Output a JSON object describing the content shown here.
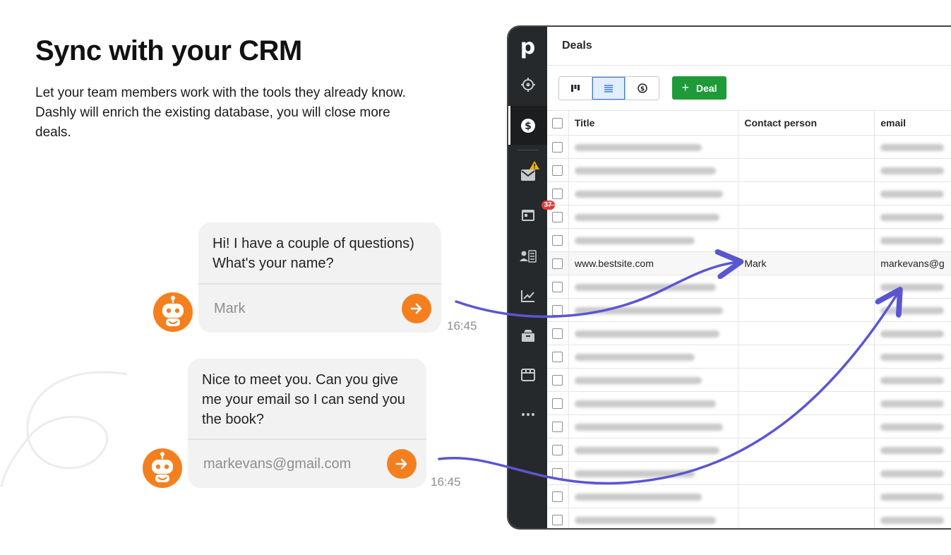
{
  "hero": {
    "title": "Sync with your CRM",
    "description": "Let your team members work with the tools they already know. Dashly will enrich the existing database, you will close more deals."
  },
  "chat": [
    {
      "message": "Hi! I have a couple of questions) What's your name?",
      "input_value": "Mark",
      "time": "16:45"
    },
    {
      "message": "Nice to meet you. Can you give me your email so I can send you the book?",
      "input_value": "markevans@gmail.com",
      "time": "16:45"
    }
  ],
  "crm": {
    "logo": "p",
    "page_title": "Deals",
    "add_button_label": "Deal",
    "badge_count": "37",
    "columns": [
      "Title",
      "Contact person",
      "email"
    ],
    "rows": [
      {
        "title": "",
        "contact": "",
        "email": ""
      },
      {
        "title": "",
        "contact": "",
        "email": ""
      },
      {
        "title": "",
        "contact": "",
        "email": ""
      },
      {
        "title": "",
        "contact": "",
        "email": ""
      },
      {
        "title": "",
        "contact": "",
        "email": ""
      },
      {
        "title": "www.bestsite.com",
        "contact": "Mark",
        "email": "markevans@g"
      },
      {
        "title": "",
        "contact": "",
        "email": ""
      },
      {
        "title": "",
        "contact": "",
        "email": ""
      },
      {
        "title": "",
        "contact": "",
        "email": ""
      },
      {
        "title": "",
        "contact": "",
        "email": ""
      },
      {
        "title": "",
        "contact": "",
        "email": ""
      },
      {
        "title": "",
        "contact": "",
        "email": ""
      },
      {
        "title": "",
        "contact": "",
        "email": ""
      },
      {
        "title": "",
        "contact": "",
        "email": ""
      },
      {
        "title": "",
        "contact": "",
        "email": ""
      },
      {
        "title": "",
        "contact": "",
        "email": ""
      },
      {
        "title": "",
        "contact": "",
        "email": ""
      }
    ]
  },
  "colors": {
    "accent_orange": "#f47f1f",
    "arrow_purple": "#5a56d2",
    "deal_green": "#1e9a38",
    "sidebar_dark": "#26292c"
  },
  "icons": [
    "robot-avatar-icon",
    "arrow-right-icon",
    "target-icon",
    "dollar-icon",
    "mail-icon",
    "warning-icon",
    "calendar-icon",
    "contacts-icon",
    "chart-icon",
    "box-icon",
    "store-icon",
    "more-icon",
    "kanban-icon",
    "list-icon",
    "forecast-icon"
  ]
}
